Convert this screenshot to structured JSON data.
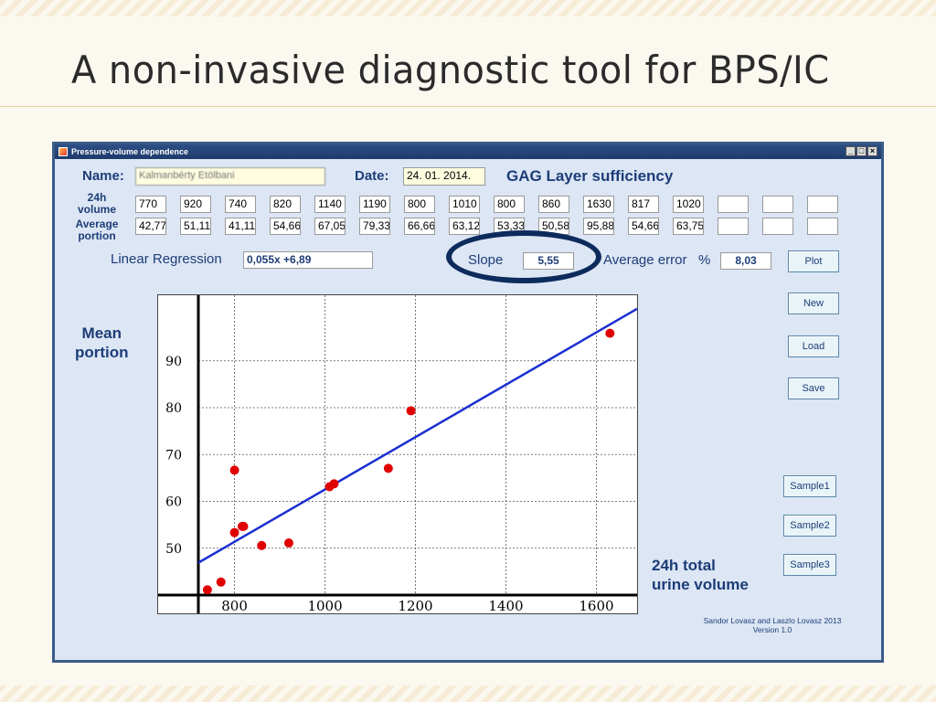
{
  "slide": {
    "title": "A non-invasive diagnostic tool for BPS/IC"
  },
  "window": {
    "title": "Pressure-volume dependence",
    "controls": {
      "minimize": "_",
      "maximize": "□",
      "close": "×"
    }
  },
  "form": {
    "name_label": "Name:",
    "name_value": "Kalmanbérty Etölbani",
    "date_label": "Date:",
    "date_value": "24. 01. 2014.",
    "heading": "GAG Layer sufficiency",
    "volume_label_1": "24h",
    "volume_label_2": "volume",
    "portion_label_1": "Average",
    "portion_label_2": "portion",
    "volumes": [
      "770",
      "920",
      "740",
      "820",
      "1140",
      "1190",
      "800",
      "1010",
      "800",
      "860",
      "1630",
      "817",
      "1020",
      "",
      "",
      ""
    ],
    "portions": [
      "42,77",
      "51,11",
      "41,11",
      "54,66",
      "67,05",
      "79,33",
      "66,66",
      "63,12",
      "53,33",
      "50,58",
      "95,88",
      "54,66",
      "63,75",
      "",
      "",
      ""
    ],
    "regression_label": "Linear Regression",
    "regression_value": "0,055x +6,89",
    "slope_label": "Slope",
    "slope_value": "5,55",
    "avg_error_label": "Average error",
    "avg_error_unit": "%",
    "avg_error_value": "8,03"
  },
  "buttons": {
    "plot": "Plot",
    "new": "New",
    "load": "Load",
    "save": "Save",
    "sample1": "Sample1",
    "sample2": "Sample2",
    "sample3": "Sample3"
  },
  "axis_text": {
    "y_label_1": "Mean",
    "y_label_2": "portion",
    "x_label_1": "24h total",
    "x_label_2": "urine volume"
  },
  "highlight_color": "#0d2a5c",
  "credits": {
    "line1": "Sandor Lovasz and Laszlo Lovasz 2013",
    "line2": "Version 1.0"
  },
  "chart_data": {
    "type": "scatter",
    "xlim": [
      720,
      1690
    ],
    "ylim": [
      40,
      104
    ],
    "x_ticks": [
      800,
      1000,
      1200,
      1400,
      1600
    ],
    "y_ticks": [
      50,
      60,
      70,
      80,
      90
    ],
    "grid": true,
    "point_color": "#e00000",
    "line_color": "#1a2fd0",
    "points": [
      {
        "x": 740,
        "y": 41.11
      },
      {
        "x": 770,
        "y": 42.77
      },
      {
        "x": 800,
        "y": 66.66
      },
      {
        "x": 800,
        "y": 53.33
      },
      {
        "x": 817,
        "y": 54.66
      },
      {
        "x": 820,
        "y": 54.66
      },
      {
        "x": 860,
        "y": 50.58
      },
      {
        "x": 920,
        "y": 51.11
      },
      {
        "x": 1010,
        "y": 63.12
      },
      {
        "x": 1020,
        "y": 63.75
      },
      {
        "x": 1140,
        "y": 67.05
      },
      {
        "x": 1190,
        "y": 79.33
      },
      {
        "x": 1630,
        "y": 95.88
      }
    ],
    "fit_line": {
      "x": [
        720,
        1690
      ],
      "y": [
        46.9,
        101.1
      ]
    }
  }
}
